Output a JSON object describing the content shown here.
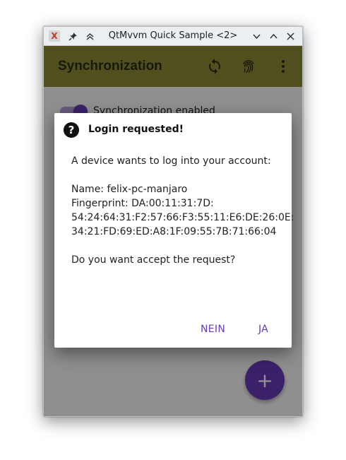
{
  "window": {
    "title": "QtMvvm Quick Sample <2>",
    "app_icon": "X",
    "titlebar_icons": {
      "pin": "pin-icon",
      "keep_above": "keep-above-icon",
      "minimize": "chevron-down-icon",
      "maximize": "chevron-up-icon",
      "close": "close-icon"
    }
  },
  "appbar": {
    "title": "Synchronization",
    "actions": [
      "sync-icon",
      "fingerprint-icon",
      "more-vert-icon"
    ]
  },
  "content": {
    "switch_label": "Synchronization enabled",
    "switch_on": true,
    "fab_label": "+"
  },
  "dialog": {
    "icon": "?",
    "title": "Login requested!",
    "intro": "A device wants to log into your account:",
    "name_line": "Name: felix-pc-manjaro",
    "fingerprint_line1": "Fingerprint: DA:00:11:31:7D:",
    "fingerprint_line2": "54:24:64:31:F2:57:66:F3:55:11:E6:DE:26:0E:",
    "fingerprint_line3": "34:21:FD:69:ED:A8:1F:09:55:7B:71:66:04",
    "question": "Do you want accept the request?",
    "button_no": "NEIN",
    "button_yes": "JA"
  },
  "colors": {
    "appbar": "#8b8a35",
    "accent": "#673ab7"
  }
}
